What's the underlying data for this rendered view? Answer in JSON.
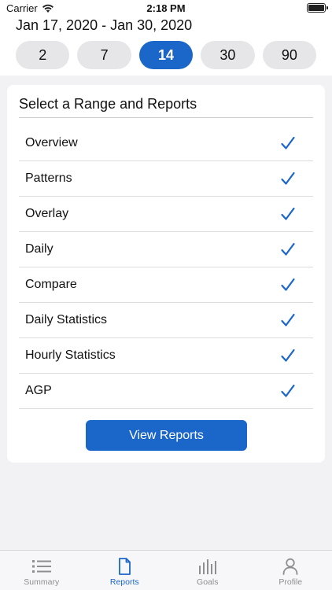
{
  "status_bar": {
    "carrier": "Carrier",
    "time": "2:18 PM"
  },
  "date_range": "Jan 17, 2020 - Jan 30, 2020",
  "range_options": [
    {
      "label": "2",
      "selected": false
    },
    {
      "label": "7",
      "selected": false
    },
    {
      "label": "14",
      "selected": true
    },
    {
      "label": "30",
      "selected": false
    },
    {
      "label": "90",
      "selected": false
    }
  ],
  "card": {
    "title": "Select a Range and Reports",
    "reports": [
      {
        "label": "Overview",
        "checked": true
      },
      {
        "label": "Patterns",
        "checked": true
      },
      {
        "label": "Overlay",
        "checked": true
      },
      {
        "label": "Daily",
        "checked": true
      },
      {
        "label": "Compare",
        "checked": true
      },
      {
        "label": "Daily Statistics",
        "checked": true
      },
      {
        "label": "Hourly Statistics",
        "checked": true
      },
      {
        "label": "AGP",
        "checked": true
      }
    ],
    "view_button": "View Reports"
  },
  "tab_bar": {
    "tabs": [
      {
        "label": "Summary",
        "icon": "list-icon",
        "active": false
      },
      {
        "label": "Reports",
        "icon": "document-icon",
        "active": true
      },
      {
        "label": "Goals",
        "icon": "bar-chart-icon",
        "active": false
      },
      {
        "label": "Profile",
        "icon": "person-icon",
        "active": false
      }
    ]
  },
  "colors": {
    "accent": "#1b66c9",
    "inactive_tab": "#8e8e93",
    "background": "#f2f2f4",
    "range_button": "#e6e6e8"
  }
}
